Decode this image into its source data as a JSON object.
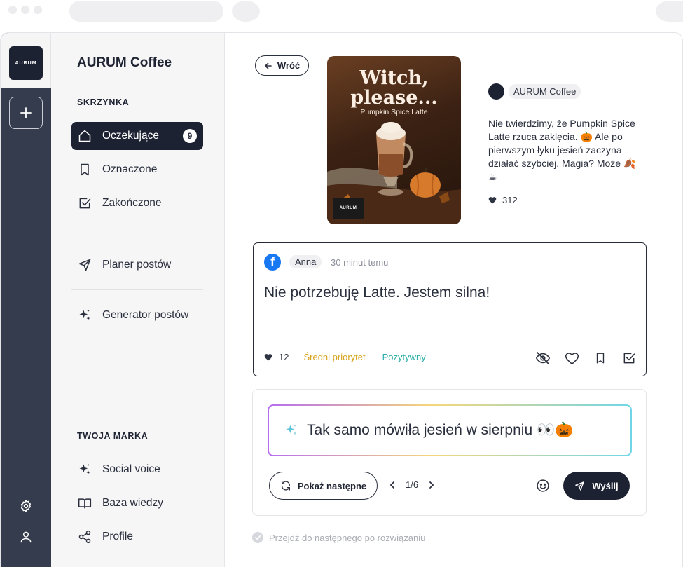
{
  "app": {
    "logo_text": "AURUM",
    "brand": "AURUM Coffee"
  },
  "sidebar": {
    "section_inbox": "SKRZYNKA",
    "inbox_items": [
      {
        "label": "Oczekujące",
        "icon": "home-icon",
        "badge": "9",
        "active": true
      },
      {
        "label": "Oznaczone",
        "icon": "bookmark-icon"
      },
      {
        "label": "Zakończone",
        "icon": "check-square-icon"
      }
    ],
    "planner": {
      "label": "Planer postów",
      "icon": "send-icon"
    },
    "generator": {
      "label": "Generator postów",
      "icon": "sparkles-icon"
    },
    "section_brand": "TWOJA MARKA",
    "brand_items": [
      {
        "label": "Social voice",
        "icon": "sparkles-icon"
      },
      {
        "label": "Baza wiedzy",
        "icon": "book-icon"
      },
      {
        "label": "Profile",
        "icon": "share-icon"
      }
    ]
  },
  "post": {
    "back_label": "Wróć",
    "image_title": "Witch, please...",
    "image_subtitle": "Pumpkin Spice Latte",
    "image_logo": "AURUM",
    "author": "AURUM Coffee",
    "text": "Nie twierdzimy, że Pumpkin Spice Latte rzuca zaklęcia. 🎃 Ale po pierwszym łyku jesień zaczyna działać szybciej. Magia? Może 🍂☕",
    "likes": "312"
  },
  "comment": {
    "platform": "facebook",
    "author": "Anna",
    "time": "30 minut temu",
    "text": "Nie potrzebuję Latte. Jestem silna!",
    "likes": "12",
    "priority": "Średni priorytet",
    "sentiment": "Pozytywny",
    "colors": {
      "priority": "#d6a21a",
      "sentiment": "#2aaea8"
    }
  },
  "reply": {
    "text": "Tak samo mówiła jesień w sierpniu 👀🎃",
    "next_label": "Pokaż następne",
    "pager": "1/6",
    "send_label": "Wyślij"
  },
  "auto_next_label": "Przejdź do następnego po rozwiązaniu",
  "colors": {
    "accent": "#1d2232",
    "rail": "#353c4e"
  }
}
